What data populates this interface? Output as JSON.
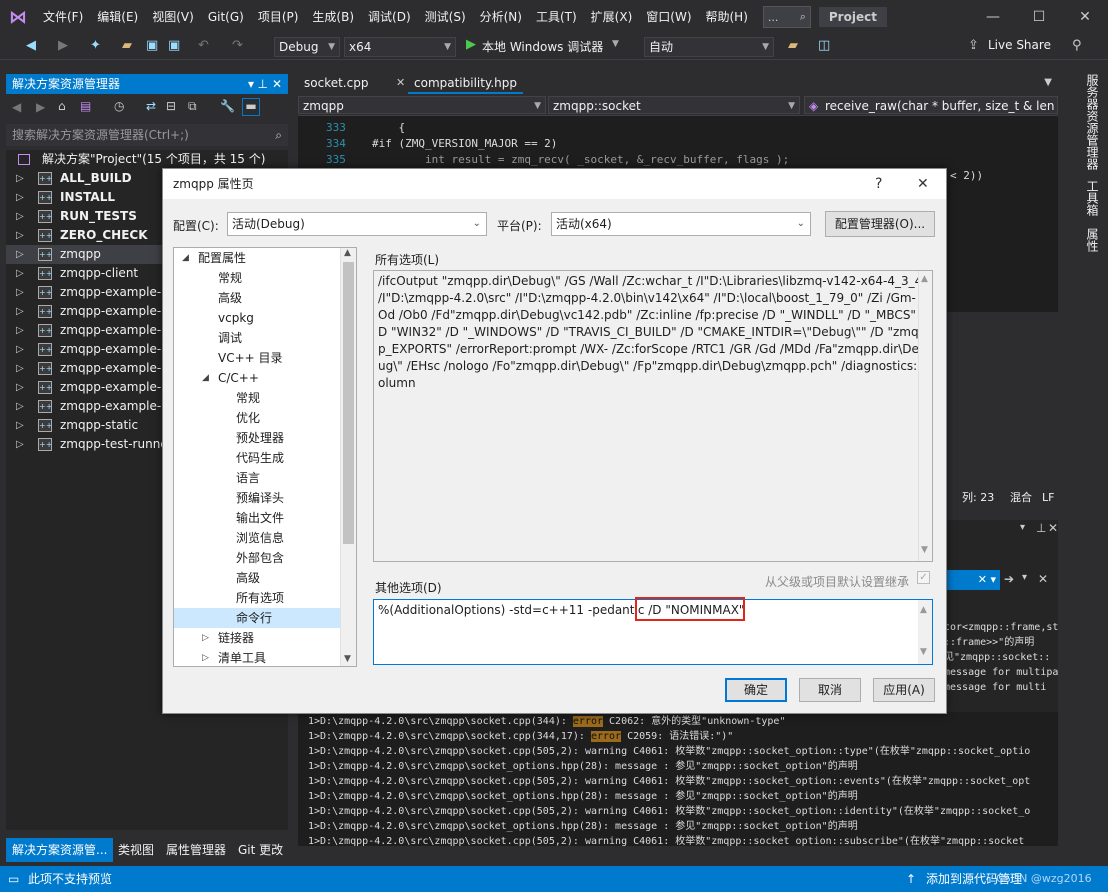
{
  "menubar": {
    "items": [
      "文件(F)",
      "编辑(E)",
      "视图(V)",
      "Git(G)",
      "项目(P)",
      "生成(B)",
      "调试(D)",
      "测试(S)",
      "分析(N)",
      "工具(T)",
      "扩展(X)",
      "窗口(W)",
      "帮助(H)"
    ],
    "search_text": "...",
    "project_badge": "Project"
  },
  "toolbar": {
    "config": "Debug",
    "platform": "x64",
    "run_label": "本地 Windows 调试器",
    "auto": "自动",
    "live_share": "Live Share"
  },
  "solution_explorer": {
    "title": "解决方案资源管理器",
    "search_placeholder": "搜索解决方案资源管理器(Ctrl+;)",
    "solution_label": "解决方案\"Project\"(15 个项目，共 15 个)",
    "items": [
      "ALL_BUILD",
      "INSTALL",
      "RUN_TESTS",
      "ZERO_CHECK",
      "zmqpp",
      "zmqpp-client",
      "zmqpp-example-",
      "zmqpp-example-",
      "zmqpp-example-",
      "zmqpp-example-",
      "zmqpp-example-",
      "zmqpp-example-",
      "zmqpp-example-",
      "zmqpp-static",
      "zmqpp-test-runne"
    ],
    "bottom_tabs": [
      "解决方案资源管...",
      "类视图",
      "属性管理器",
      "Git 更改"
    ]
  },
  "editor": {
    "tabs": [
      "socket.cpp",
      "compatibility.hpp"
    ],
    "nav": [
      "zmqpp",
      "zmqpp::socket",
      "receive_raw(char * buffer, size_t & len"
    ],
    "lines": [
      {
        "no": "333",
        "text": "    {"
      },
      {
        "no": "334",
        "text": "#if (ZMQ_VERSION_MAJOR == 2)"
      },
      {
        "no": "335",
        "text": "        int result = zmq_recv( _socket, &_recv_buffer, flags );"
      }
    ],
    "peek_text": "< 2))",
    "status": {
      "col": "列: 23",
      "mixed": "混合",
      "lf": "LF"
    }
  },
  "right_side_tabs": [
    "服务器资源管理器",
    "工具箱",
    "属性"
  ],
  "output": {
    "lines": [
      {
        "text": "1>D:\\zmqpp-4.2.0\\src\\zmqpp\\socket.cpp(344): ",
        "tag": "error",
        "rest": " C2062: 意外的类型\"unknown-type\""
      },
      {
        "text": "1>D:\\zmqpp-4.2.0\\src\\zmqpp\\socket.cpp(344,17): ",
        "tag": "error",
        "rest": " C2059: 语法错误:\")\""
      },
      {
        "text": "1>D:\\zmqpp-4.2.0\\src\\zmqpp\\socket.cpp(505,2): warning C4061: 枚举数\"zmqpp::socket_option::type\"(在枚举\"zmqpp::socket_optio",
        "tag": "",
        "rest": ""
      },
      {
        "text": "1>D:\\zmqpp-4.2.0\\src\\zmqpp\\socket_options.hpp(28): message : 参见\"zmqpp::socket_option\"的声明",
        "tag": "",
        "rest": ""
      },
      {
        "text": "1>D:\\zmqpp-4.2.0\\src\\zmqpp\\socket.cpp(505,2): warning C4061: 枚举数\"zmqpp::socket_option::events\"(在枚举\"zmqpp::socket_opt",
        "tag": "",
        "rest": ""
      },
      {
        "text": "1>D:\\zmqpp-4.2.0\\src\\zmqpp\\socket_options.hpp(28): message : 参见\"zmqpp::socket_option\"的声明",
        "tag": "",
        "rest": ""
      },
      {
        "text": "1>D:\\zmqpp-4.2.0\\src\\zmqpp\\socket.cpp(505,2): warning C4061: 枚举数\"zmqpp::socket_option::identity\"(在枚举\"zmqpp::socket_o",
        "tag": "",
        "rest": ""
      },
      {
        "text": "1>D:\\zmqpp-4.2.0\\src\\zmqpp\\socket_options.hpp(28): message : 参见\"zmqpp::socket_option\"的声明",
        "tag": "",
        "rest": ""
      },
      {
        "text": "1>D:\\zmqpp-4.2.0\\src\\zmqpp\\socket.cpp(505,2): warning C4061: 枚举数\"zmqpp::socket_option::subscribe\"(在枚举\"zmqpp::socket",
        "tag": "",
        "rest": ""
      }
    ],
    "right_fragments": [
      "tor<zmqpp::frame,st",
      "::frame>>\"的声明",
      "见\"zmqpp::socket::",
      "message for multipa",
      "message for multi"
    ]
  },
  "dialog": {
    "title": "zmqpp 属性页",
    "help": "?",
    "close": "✕",
    "config_label": "配置(C):",
    "config_value": "活动(Debug)",
    "platform_label": "平台(P):",
    "platform_value": "活动(x64)",
    "config_manager": "配置管理器(O)...",
    "tree": [
      {
        "label": "配置属性",
        "level": 0,
        "exp": "open"
      },
      {
        "label": "常规",
        "level": 1
      },
      {
        "label": "高级",
        "level": 1
      },
      {
        "label": "vcpkg",
        "level": 1
      },
      {
        "label": "调试",
        "level": 1
      },
      {
        "label": "VC++ 目录",
        "level": 1
      },
      {
        "label": "C/C++",
        "level": 1,
        "exp": "open"
      },
      {
        "label": "常规",
        "level": 2
      },
      {
        "label": "优化",
        "level": 2
      },
      {
        "label": "预处理器",
        "level": 2
      },
      {
        "label": "代码生成",
        "level": 2
      },
      {
        "label": "语言",
        "level": 2
      },
      {
        "label": "预编译头",
        "level": 2
      },
      {
        "label": "输出文件",
        "level": 2
      },
      {
        "label": "浏览信息",
        "level": 2
      },
      {
        "label": "外部包含",
        "level": 2
      },
      {
        "label": "高级",
        "level": 2
      },
      {
        "label": "所有选项",
        "level": 2
      },
      {
        "label": "命令行",
        "level": 2,
        "sel": true
      },
      {
        "label": "链接器",
        "level": 1,
        "exp": "closed"
      },
      {
        "label": "清单工具",
        "level": 1,
        "exp": "closed"
      }
    ],
    "all_options_label": "所有选项(L)",
    "all_options_text": "/ifcOutput \"zmqpp.dir\\Debug\\\" /GS /Wall /Zc:wchar_t /I\"D:\\Libraries\\libzmq-v142-x64-4_3_4\" /I\"D:\\zmqpp-4.2.0\\src\" /I\"D:\\zmqpp-4.2.0\\bin\\v142\\x64\" /I\"D:\\local\\boost_1_79_0\" /Zi /Gm- /Od /Ob0 /Fd\"zmqpp.dir\\Debug\\vc142.pdb\" /Zc:inline /fp:precise /D \"_WINDLL\" /D \"_MBCS\" /D \"WIN32\" /D \"_WINDOWS\" /D \"TRAVIS_CI_BUILD\" /D \"CMAKE_INTDIR=\\\"Debug\\\"\" /D \"zmqpp_EXPORTS\" /errorReport:prompt /WX- /Zc:forScope /RTC1 /GR /Gd /MDd /Fa\"zmqpp.dir\\Debug\\\" /EHsc /nologo /Fo\"zmqpp.dir\\Debug\\\" /Fp\"zmqpp.dir\\Debug\\zmqpp.pch\" /diagnostics:column",
    "other_options_label": "其他选项(D)",
    "inherit_label": "从父级或项目默认设置继承",
    "other_options_value": "%(AdditionalOptions) -std=c++11 -pedantic /D \"NOMINMAX\"",
    "ok": "确定",
    "cancel": "取消",
    "apply": "应用(A)"
  },
  "statusbar": {
    "left": "此项不支持预览",
    "right": "添加到源代码管理",
    "watermark": "CSDN @wzg2016"
  }
}
